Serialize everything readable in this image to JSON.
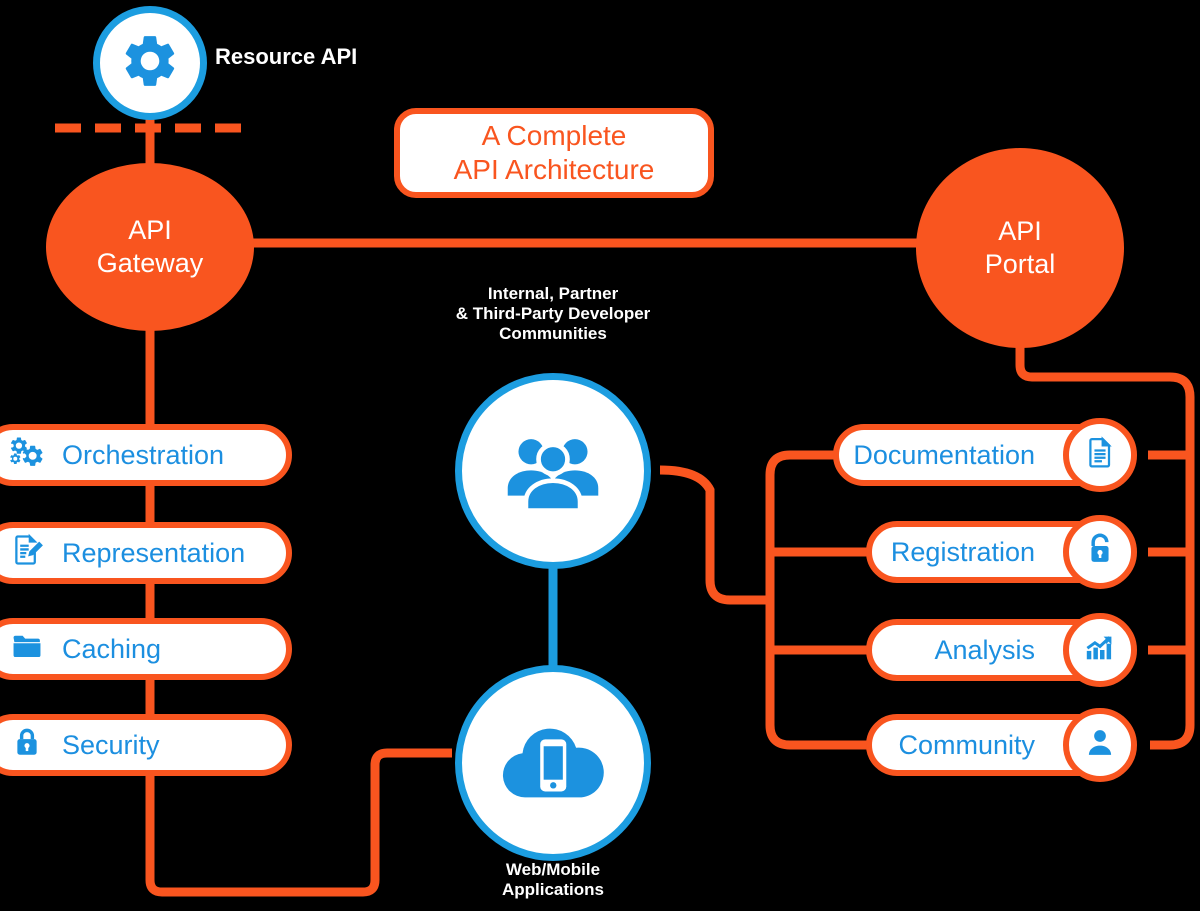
{
  "title_box": {
    "line1": "A Complete",
    "line2": "API Architecture",
    "color": "#F9551F"
  },
  "nodes": {
    "resource_api": {
      "label": "Resource API",
      "icon": "gear-icon"
    },
    "api_gateway": {
      "line1": "API",
      "line2": "Gateway",
      "color": "#F9551F"
    },
    "api_portal": {
      "line1": "API",
      "line2": "Portal",
      "color": "#F9551F"
    },
    "developer_communities": {
      "line1": "Internal, Partner",
      "line2": "& Third-Party Developer",
      "line3": "Communities",
      "icon": "people-group-icon"
    },
    "web_mobile_apps": {
      "line1": "Web/Mobile",
      "line2": "Applications",
      "icon": "cloud-mobile-icon"
    }
  },
  "gateway_capabilities": [
    {
      "label": "Orchestration",
      "icon": "gears-icon"
    },
    {
      "label": "Representation",
      "icon": "document-edit-icon"
    },
    {
      "label": "Caching",
      "icon": "folder-icon"
    },
    {
      "label": "Security",
      "icon": "lock-icon"
    }
  ],
  "portal_capabilities": [
    {
      "label": "Documentation",
      "icon": "document-icon"
    },
    {
      "label": "Registration",
      "icon": "unlock-icon"
    },
    {
      "label": "Analysis",
      "icon": "chart-up-icon"
    },
    {
      "label": "Community",
      "icon": "person-icon"
    }
  ],
  "colors": {
    "orange": "#F9551F",
    "blue": "#1C92DF",
    "background": "#000000",
    "white": "#FFFFFF"
  }
}
